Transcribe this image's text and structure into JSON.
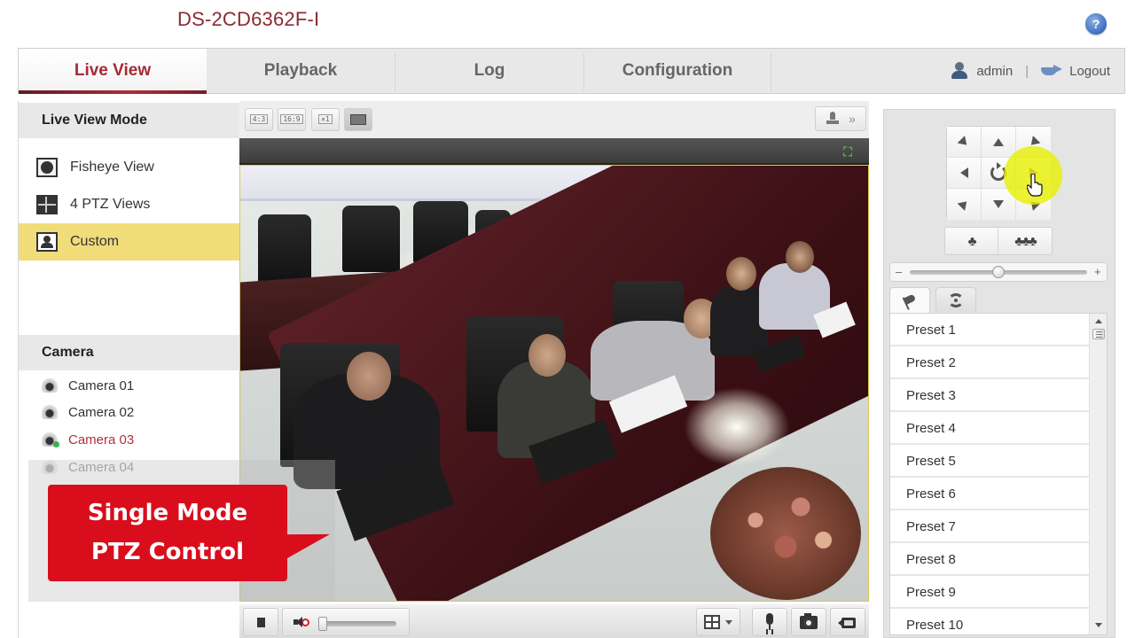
{
  "header": {
    "device_title": "DS-2CD6362F-I",
    "help_icon": "help-icon",
    "help_label": "?"
  },
  "nav": {
    "tabs": [
      {
        "label": "Live View",
        "active": true
      },
      {
        "label": "Playback",
        "active": false
      },
      {
        "label": "Log",
        "active": false
      },
      {
        "label": "Configuration",
        "active": false
      }
    ],
    "user": "admin",
    "separator": "|",
    "logout_label": "Logout",
    "accent_color": "#a52a35"
  },
  "sidebar": {
    "live_view_mode": {
      "title": "Live View Mode",
      "items": [
        {
          "label": "Fisheye View",
          "icon": "fisheye-icon",
          "active": false
        },
        {
          "label": "4 PTZ Views",
          "icon": "quad-view-icon",
          "active": false
        },
        {
          "label": "Custom",
          "icon": "custom-view-icon",
          "active": true
        }
      ],
      "active_color": "#f1dc7a"
    },
    "camera": {
      "title": "Camera",
      "items": [
        {
          "label": "Camera 01",
          "state": "normal"
        },
        {
          "label": "Camera 02",
          "state": "normal"
        },
        {
          "label": "Camera 03",
          "state": "active"
        },
        {
          "label": "Camera 04",
          "state": "dim"
        }
      ]
    }
  },
  "video_toolbar": {
    "ratio_buttons": [
      {
        "label": "4:3",
        "name": "ratio-4-3"
      },
      {
        "label": "16:9",
        "name": "ratio-16-9"
      },
      {
        "label": "×1",
        "name": "ratio-original"
      },
      {
        "label": "",
        "name": "ratio-auto",
        "active": true
      }
    ],
    "ptz_toggle_icon": "ptz-stamp-icon",
    "ptz_toggle_chevron": "»",
    "fullscreen_icon": "fullscreen-icon",
    "fullscreen_glyph": "⛶"
  },
  "video_controls": {
    "stop_icon": "stop-icon",
    "volume_muted": true,
    "volume_level_percent": 0,
    "layout_icon": "window-layout-icon",
    "buttons": [
      "microphone-icon",
      "capture-icon",
      "record-icon"
    ]
  },
  "ptz": {
    "directions": [
      "up-left",
      "up",
      "up-right",
      "left",
      "auto",
      "right",
      "down-left",
      "down",
      "down-right"
    ],
    "hovered_direction": "right",
    "zoom_in_glyph": "♣",
    "zoom_out_glyph": "♣♣♣",
    "speed_minus": "–",
    "speed_plus": "+",
    "speed_level_percent": 50,
    "tabs": [
      {
        "name": "preset-tab",
        "icon": "flag-icon",
        "active": true
      },
      {
        "name": "patrol-tab",
        "icon": "patrol-icon",
        "active": false
      }
    ],
    "presets": [
      "Preset 1",
      "Preset 2",
      "Preset 3",
      "Preset 4",
      "Preset 5",
      "Preset 6",
      "Preset 7",
      "Preset 8",
      "Preset 9",
      "Preset 10"
    ]
  },
  "annotation": {
    "line1": "Single Mode",
    "line2": "PTZ Control",
    "color": "#d90d1c"
  }
}
